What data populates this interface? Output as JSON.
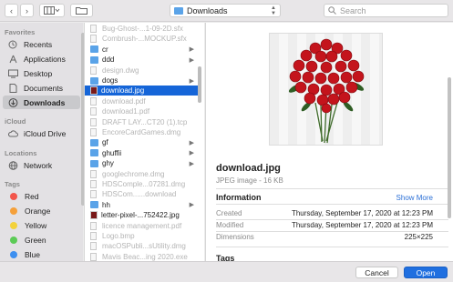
{
  "toolbar": {
    "location": "Downloads",
    "search_placeholder": "Search"
  },
  "sidebar": {
    "favorites_heading": "Favorites",
    "favorites": [
      {
        "label": "Recents",
        "icon": "clock-icon"
      },
      {
        "label": "Applications",
        "icon": "applications-icon"
      },
      {
        "label": "Desktop",
        "icon": "desktop-icon"
      },
      {
        "label": "Documents",
        "icon": "documents-icon"
      },
      {
        "label": "Downloads",
        "icon": "download-icon",
        "selected": true
      }
    ],
    "icloud_heading": "iCloud",
    "icloud": [
      {
        "label": "iCloud Drive",
        "icon": "cloud-icon"
      }
    ],
    "locations_heading": "Locations",
    "locations": [
      {
        "label": "Network",
        "icon": "globe-icon"
      }
    ],
    "tags_heading": "Tags",
    "tags": [
      {
        "label": "Red",
        "color": "#f2554b"
      },
      {
        "label": "Orange",
        "color": "#f5a03a"
      },
      {
        "label": "Yellow",
        "color": "#f3d23b"
      },
      {
        "label": "Green",
        "color": "#5ccb56"
      },
      {
        "label": "Blue",
        "color": "#3d8ff0"
      }
    ]
  },
  "files": [
    {
      "name": "Bug-Ghost-...1-09-2D.sfx",
      "type": "doc",
      "dim": true
    },
    {
      "name": "Combrush-...MOCKUP.sfx",
      "type": "doc",
      "dim": true
    },
    {
      "name": "cr",
      "type": "folder",
      "arrow": true
    },
    {
      "name": "ddd",
      "type": "folder",
      "arrow": true
    },
    {
      "name": "design.dwg",
      "type": "doc",
      "dim": true
    },
    {
      "name": "dogs",
      "type": "folder",
      "arrow": true
    },
    {
      "name": "download.jpg",
      "type": "image",
      "selected": true
    },
    {
      "name": "download.pdf",
      "type": "doc",
      "dim": true
    },
    {
      "name": "download1.pdf",
      "type": "doc",
      "dim": true
    },
    {
      "name": "DRAFT LAY...CT20 (1).tcp",
      "type": "doc",
      "dim": true
    },
    {
      "name": "EncoreCardGames.dmg",
      "type": "doc",
      "dim": true
    },
    {
      "name": "gf",
      "type": "folder",
      "arrow": true
    },
    {
      "name": "ghuffii",
      "type": "folder",
      "arrow": true
    },
    {
      "name": "ghy",
      "type": "folder",
      "arrow": true
    },
    {
      "name": "googlechrome.dmg",
      "type": "doc",
      "dim": true
    },
    {
      "name": "HDSComple...07281.dmg",
      "type": "doc",
      "dim": true
    },
    {
      "name": "HDSCom......download",
      "type": "doc",
      "dim": true
    },
    {
      "name": "hh",
      "type": "folder",
      "arrow": true
    },
    {
      "name": "letter-pixel-...752422.jpg",
      "type": "image"
    },
    {
      "name": "licence management.pdf",
      "type": "doc",
      "dim": true
    },
    {
      "name": "Logo.bmp",
      "type": "doc",
      "dim": true
    },
    {
      "name": "macOSPubli...sUtility.dmg",
      "type": "doc",
      "dim": true
    },
    {
      "name": "Mavis Beac...ing 2020.exe",
      "type": "doc",
      "dim": true
    }
  ],
  "preview": {
    "name": "download.jpg",
    "kind": "JPEG image - 16 KB",
    "info_heading": "Information",
    "show_more": "Show More",
    "rows": [
      {
        "key": "Created",
        "value": "Thursday, September 17, 2020 at 12:23 PM"
      },
      {
        "key": "Modified",
        "value": "Thursday, September 17, 2020 at 12:23 PM"
      },
      {
        "key": "Dimensions",
        "value": "225×225"
      }
    ],
    "tags_heading": "Tags"
  },
  "buttons": {
    "cancel": "Cancel",
    "open": "Open"
  }
}
